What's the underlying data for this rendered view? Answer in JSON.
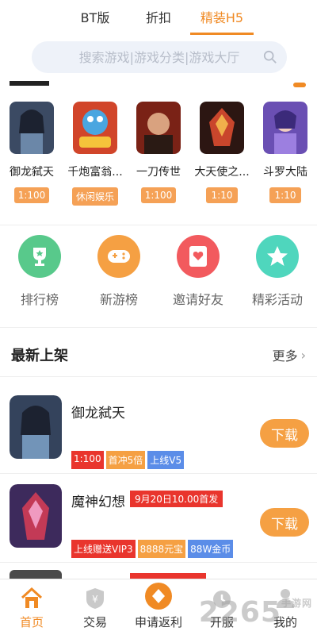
{
  "colors": {
    "accent": "#f08a24",
    "badge": "#f5a156",
    "red": "#e9352d",
    "blue": "#5b8de8"
  },
  "top_tabs": [
    {
      "label": "BT版"
    },
    {
      "label": "折扣"
    },
    {
      "label": "精装H5",
      "active": true
    }
  ],
  "search": {
    "placeholder": "搜索游戏|游戏分类|游戏大厅",
    "icon": "search-icon"
  },
  "games": [
    {
      "name": "御龙弑天",
      "badge": "1:100"
    },
    {
      "name": "千炮富翁...",
      "badge": "休闲娱乐"
    },
    {
      "name": "一刀传世",
      "badge": "1:100"
    },
    {
      "name": "大天使之...",
      "badge": "1:10"
    },
    {
      "name": "斗罗大陆",
      "badge": "1:10"
    }
  ],
  "features": [
    {
      "label": "排行榜",
      "icon": "trophy-icon"
    },
    {
      "label": "新游榜",
      "icon": "gamepad-icon"
    },
    {
      "label": "邀请好友",
      "icon": "card-icon"
    },
    {
      "label": "精彩活动",
      "icon": "star-icon"
    }
  ],
  "new_section": {
    "title": "最新上架",
    "more": "更多"
  },
  "list": [
    {
      "title": "御龙弑天",
      "hot": "",
      "tags": [
        "1:100",
        "首冲5倍",
        "上线V5"
      ],
      "button": "下载"
    },
    {
      "title": "魔神幻想",
      "hot": "9月20日10.00首发",
      "tags": [
        "上线赠送VIP3",
        "8888元宝",
        "88W金币"
      ],
      "button": "下载"
    }
  ],
  "bottom_nav": [
    {
      "label": "首页",
      "icon": "home-icon",
      "active": true
    },
    {
      "label": "交易",
      "icon": "yen-shield-icon"
    },
    {
      "label": "申请返利",
      "icon": "diamond-icon"
    },
    {
      "label": "开服",
      "icon": "alarm-icon"
    },
    {
      "label": "我的",
      "icon": "user-icon"
    }
  ],
  "watermark": {
    "text": "2265",
    "suffix": "手游网"
  }
}
